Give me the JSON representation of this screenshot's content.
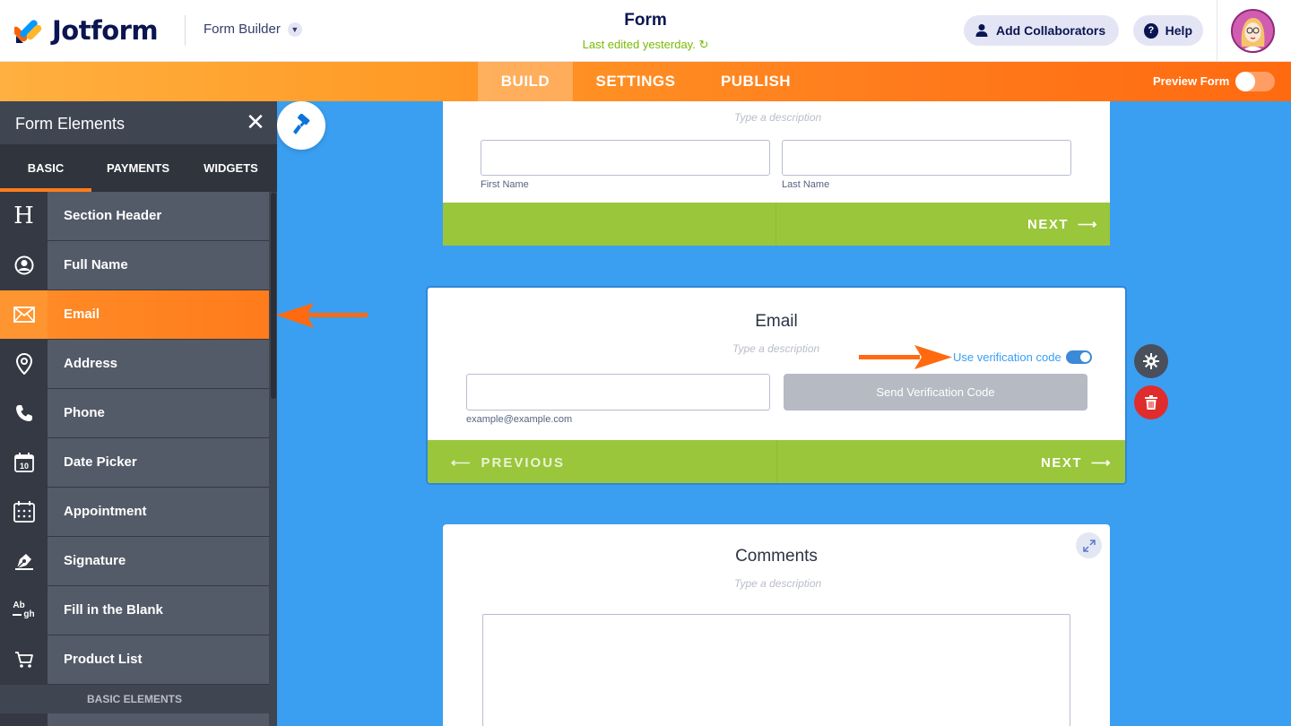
{
  "header": {
    "brand": "Jotform",
    "builder_label": "Form Builder",
    "form_title": "Form",
    "last_edited": "Last edited yesterday.",
    "add_collaborators": "Add Collaborators",
    "help": "Help"
  },
  "navbar": {
    "tabs": [
      "BUILD",
      "SETTINGS",
      "PUBLISH"
    ],
    "active_tab": "BUILD",
    "preview_label": "Preview Form",
    "preview_enabled": false
  },
  "sidebar": {
    "title": "Form Elements",
    "tabs": [
      "BASIC",
      "PAYMENTS",
      "WIDGETS"
    ],
    "active_tab": "BASIC",
    "items": [
      {
        "label": "Section Header",
        "icon": "heading-icon"
      },
      {
        "label": "Full Name",
        "icon": "user-circle-icon"
      },
      {
        "label": "Email",
        "icon": "envelope-icon",
        "active": true
      },
      {
        "label": "Address",
        "icon": "map-pin-icon"
      },
      {
        "label": "Phone",
        "icon": "phone-icon"
      },
      {
        "label": "Date Picker",
        "icon": "calendar-icon"
      },
      {
        "label": "Appointment",
        "icon": "calendar-clock-icon"
      },
      {
        "label": "Signature",
        "icon": "pen-nib-icon"
      },
      {
        "label": "Fill in the Blank",
        "icon": "fill-blank-icon"
      },
      {
        "label": "Product List",
        "icon": "cart-icon"
      }
    ],
    "section_label": "BASIC ELEMENTS",
    "calendar_day": "10",
    "fill_blank_top": "Ab",
    "fill_blank_bottom": "gh"
  },
  "canvas": {
    "name_card": {
      "description": "Type a description",
      "first_name": "First Name",
      "last_name": "Last Name",
      "next": "NEXT"
    },
    "email_card": {
      "title": "Email",
      "description": "Type a description",
      "verification_label": "Use verification code",
      "verification_enabled": true,
      "send_button": "Send Verification Code",
      "sublabel": "example@example.com",
      "previous": "PREVIOUS",
      "next": "NEXT"
    },
    "comments_card": {
      "title": "Comments",
      "description": "Type a description"
    }
  },
  "colors": {
    "brand_orange": "#ff7b1c",
    "canvas_blue": "#3a9ff1",
    "nav_green": "#9ac63b",
    "delete_red": "#e02c2c"
  }
}
